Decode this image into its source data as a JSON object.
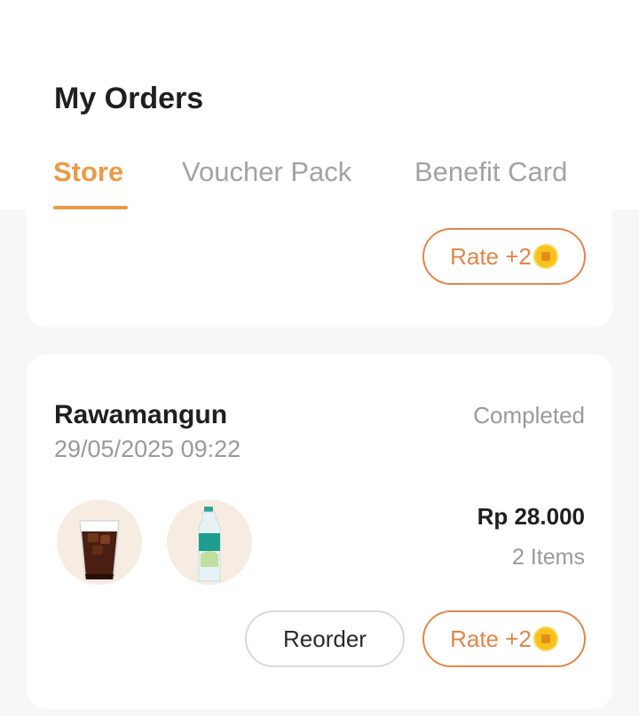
{
  "header": {
    "title": "My Orders",
    "tabs": [
      {
        "label": "Store",
        "active": true
      },
      {
        "label": "Voucher Pack",
        "active": false
      },
      {
        "label": "Benefit Card",
        "active": false
      }
    ]
  },
  "colors": {
    "accent": "#ec9a45",
    "rate": "#e4854a",
    "coin": "#f6c21b"
  },
  "orders": [
    {
      "rate_label": "Rate +2",
      "rate_icon": "coin-icon"
    },
    {
      "store": "Rawamangun",
      "datetime": "29/05/2025 09:22",
      "status": "Completed",
      "price": "Rp 28.000",
      "items": "2 Items",
      "products": [
        "iced-coffee-icon",
        "water-bottle-icon"
      ],
      "reorder_label": "Reorder",
      "rate_label": "Rate +2",
      "rate_icon": "coin-icon"
    }
  ]
}
